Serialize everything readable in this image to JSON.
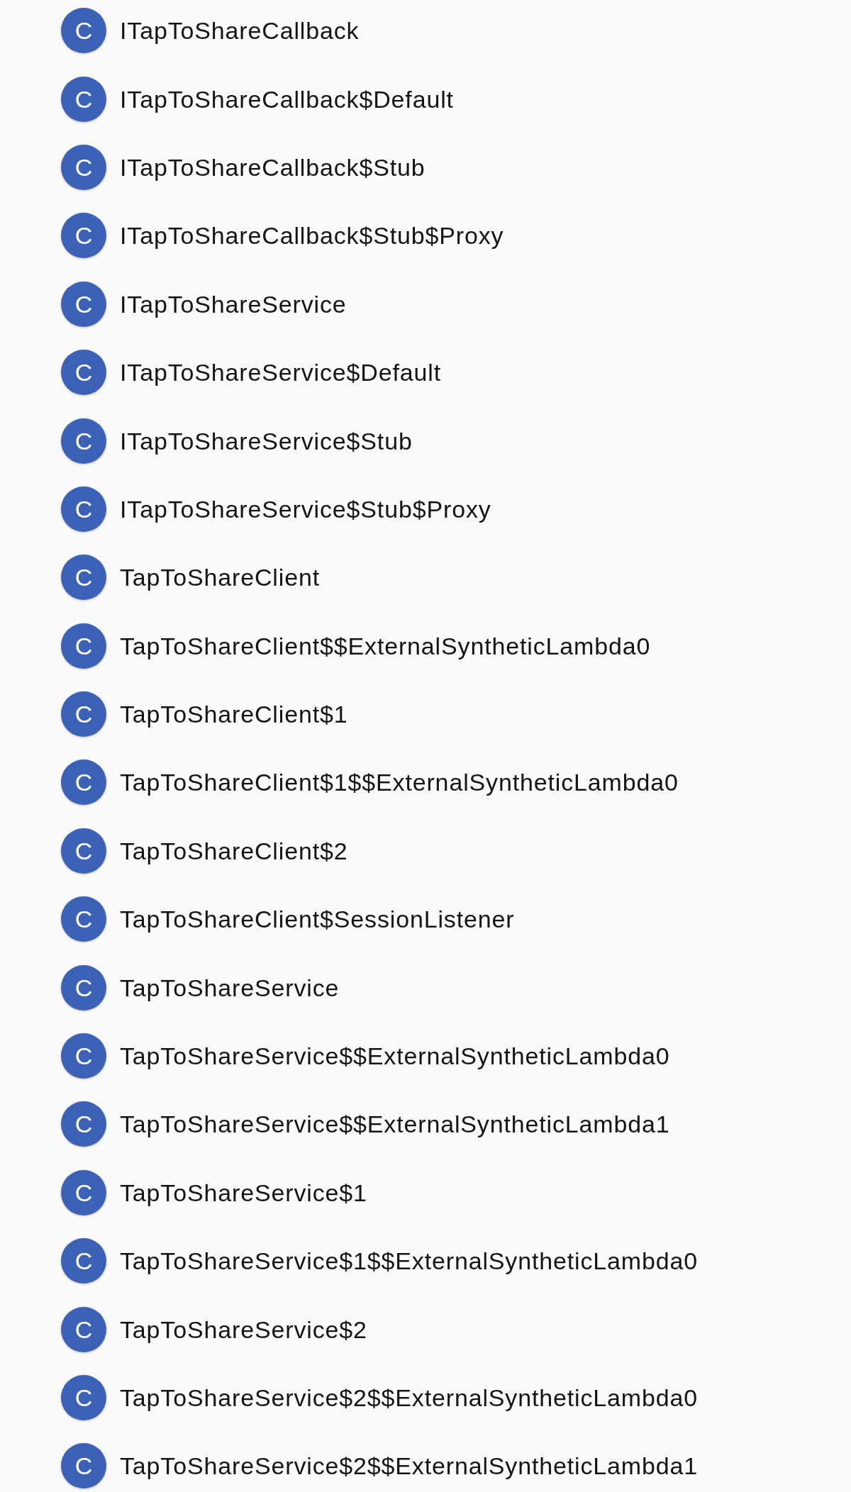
{
  "classes": [
    {
      "icon": "C",
      "name": "ITapToShareCallback"
    },
    {
      "icon": "C",
      "name": "ITapToShareCallback$Default"
    },
    {
      "icon": "C",
      "name": "ITapToShareCallback$Stub"
    },
    {
      "icon": "C",
      "name": "ITapToShareCallback$Stub$Proxy"
    },
    {
      "icon": "C",
      "name": "ITapToShareService"
    },
    {
      "icon": "C",
      "name": "ITapToShareService$Default"
    },
    {
      "icon": "C",
      "name": "ITapToShareService$Stub"
    },
    {
      "icon": "C",
      "name": "ITapToShareService$Stub$Proxy"
    },
    {
      "icon": "C",
      "name": "TapToShareClient"
    },
    {
      "icon": "C",
      "name": "TapToShareClient$$ExternalSyntheticLambda0"
    },
    {
      "icon": "C",
      "name": "TapToShareClient$1"
    },
    {
      "icon": "C",
      "name": "TapToShareClient$1$$ExternalSyntheticLambda0"
    },
    {
      "icon": "C",
      "name": "TapToShareClient$2"
    },
    {
      "icon": "C",
      "name": "TapToShareClient$SessionListener"
    },
    {
      "icon": "C",
      "name": "TapToShareService"
    },
    {
      "icon": "C",
      "name": "TapToShareService$$ExternalSyntheticLambda0"
    },
    {
      "icon": "C",
      "name": "TapToShareService$$ExternalSyntheticLambda1"
    },
    {
      "icon": "C",
      "name": "TapToShareService$1"
    },
    {
      "icon": "C",
      "name": "TapToShareService$1$$ExternalSyntheticLambda0"
    },
    {
      "icon": "C",
      "name": "TapToShareService$2"
    },
    {
      "icon": "C",
      "name": "TapToShareService$2$$ExternalSyntheticLambda0"
    },
    {
      "icon": "C",
      "name": "TapToShareService$2$$ExternalSyntheticLambda1"
    }
  ]
}
